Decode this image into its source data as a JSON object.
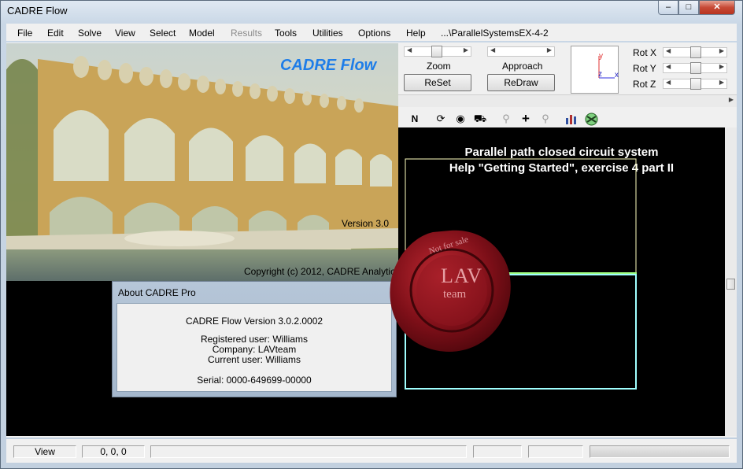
{
  "window": {
    "title": "CADRE Flow",
    "controls": {
      "minimize": "–",
      "maximize": "□",
      "close": "✕"
    }
  },
  "menubar": {
    "items": [
      "File",
      "Edit",
      "Solve",
      "View",
      "Select",
      "Model",
      "Results",
      "Tools",
      "Utilities",
      "Options",
      "Help"
    ],
    "disabled": [
      "Results"
    ],
    "path": "...\\ParallelSystemsEX-4-2"
  },
  "splash": {
    "brand": "CADRE Flow",
    "version": "Version 3.0",
    "copyright": "Copyright (c) 2012, CADRE Analytic"
  },
  "controls": {
    "zoom_label": "Zoom",
    "approach_label": "Approach",
    "reset_button": "ReSet",
    "redraw_button": "ReDraw",
    "rot_x": "Rot X",
    "rot_y": "Rot Y",
    "rot_z": "Rot Z",
    "axes": {
      "y": "y",
      "z": "z",
      "x": "x"
    }
  },
  "toolbar": {
    "icons": [
      "n-icon",
      "rotate-icon",
      "eye-icon",
      "faucet-icon",
      "zoom-out-icon",
      "add-icon",
      "zoom-in-icon",
      "chart-icon",
      "no-entry-icon"
    ],
    "n_label": "N"
  },
  "canvas": {
    "line1": "Parallel path closed circuit system",
    "line2": "Help \"Getting Started\", exercise 4 part II"
  },
  "about": {
    "title": "About CADRE Pro",
    "product": "CADRE Flow  Version 3.0.2.0002",
    "registered_user": "Registered user: Williams",
    "company": "Company: LAVteam",
    "current_user": "Current user: Williams",
    "serial": "Serial: 0000-649699-00000"
  },
  "seal": {
    "text_main": "LAV",
    "text_sub": "team",
    "ring_text": "Not for sale"
  },
  "statusbar": {
    "mode": "View",
    "coords": "0, 0, 0"
  }
}
